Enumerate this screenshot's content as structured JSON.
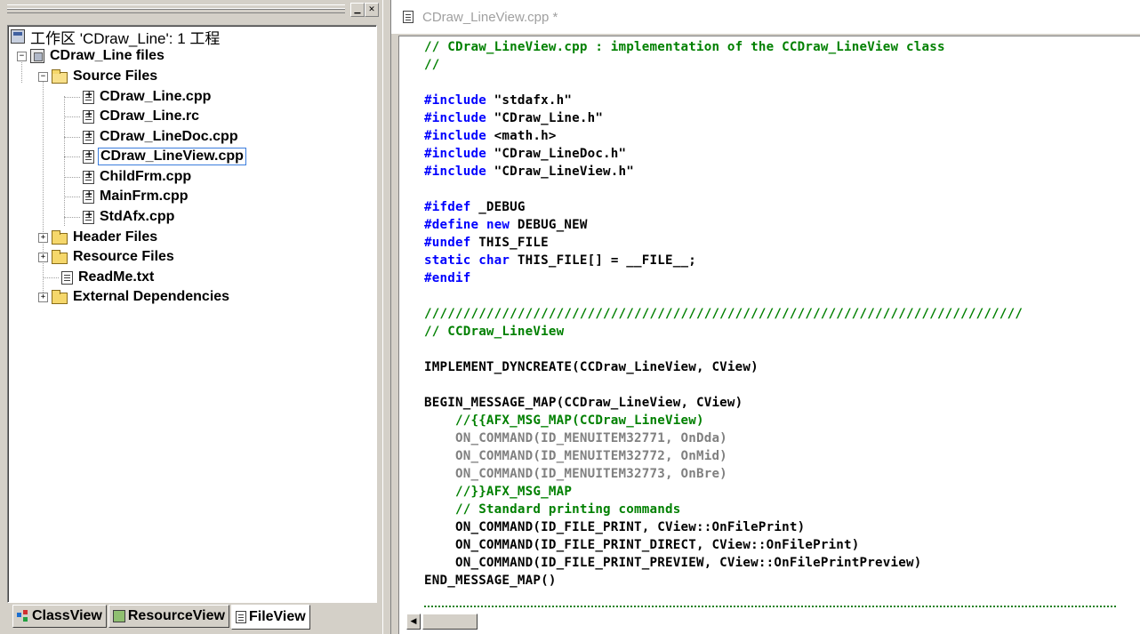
{
  "workspace": {
    "min_glyph": "▁",
    "close_glyph": "✕",
    "tree": [
      {
        "label": "工作区 'CDraw_Line': 1 工程",
        "icon": "workspace-icon"
      },
      {
        "label": "CDraw_Line files",
        "icon": "project-icon",
        "expander": "−"
      },
      {
        "label": "Source Files",
        "icon": "folder-open-icon",
        "expander": "−"
      },
      {
        "label": "CDraw_Line.cpp",
        "icon": "cpp-file-icon"
      },
      {
        "label": "CDraw_Line.rc",
        "icon": "cpp-file-icon"
      },
      {
        "label": "CDraw_LineDoc.cpp",
        "icon": "cpp-file-icon"
      },
      {
        "label": "CDraw_LineView.cpp",
        "icon": "cpp-file-icon",
        "selected": true
      },
      {
        "label": "ChildFrm.cpp",
        "icon": "cpp-file-icon"
      },
      {
        "label": "MainFrm.cpp",
        "icon": "cpp-file-icon"
      },
      {
        "label": "StdAfx.cpp",
        "icon": "cpp-file-icon"
      },
      {
        "label": "Header Files",
        "icon": "folder-icon",
        "expander": "+"
      },
      {
        "label": "Resource Files",
        "icon": "folder-icon",
        "expander": "+"
      },
      {
        "label": "ReadMe.txt",
        "icon": "text-file-icon"
      },
      {
        "label": "External Dependencies",
        "icon": "folder-icon",
        "expander": "+"
      }
    ],
    "tabs": [
      {
        "label": "ClassView",
        "icon": "classview-icon"
      },
      {
        "label": "ResourceView",
        "icon": "resourceview-icon"
      },
      {
        "label": "FileView",
        "icon": "fileview-icon",
        "active": true
      }
    ]
  },
  "editor": {
    "title": "CDraw_LineView.cpp *",
    "scroll_left_glyph": "◀",
    "lines": [
      [
        [
          "// CDraw_LineView.cpp : implementation of the CCDraw_LineView class",
          "comment"
        ]
      ],
      [
        [
          "//",
          "comment"
        ]
      ],
      [],
      [
        [
          "#include",
          "keyword"
        ],
        [
          " \"stdafx.h\"",
          "text"
        ]
      ],
      [
        [
          "#include",
          "keyword"
        ],
        [
          " \"CDraw_Line.h\"",
          "text"
        ]
      ],
      [
        [
          "#include",
          "keyword"
        ],
        [
          " <math.h>",
          "text"
        ]
      ],
      [
        [
          "#include",
          "keyword"
        ],
        [
          " \"CDraw_LineDoc.h\"",
          "text"
        ]
      ],
      [
        [
          "#include",
          "keyword"
        ],
        [
          " \"CDraw_LineView.h\"",
          "text"
        ]
      ],
      [],
      [
        [
          "#ifdef",
          "keyword"
        ],
        [
          " _DEBUG",
          "text"
        ]
      ],
      [
        [
          "#define",
          "keyword"
        ],
        [
          " ",
          "text"
        ],
        [
          "new",
          "keyword"
        ],
        [
          " DEBUG_NEW",
          "text"
        ]
      ],
      [
        [
          "#undef",
          "keyword"
        ],
        [
          " THIS_FILE",
          "text"
        ]
      ],
      [
        [
          "static",
          "keyword"
        ],
        [
          " ",
          "text"
        ],
        [
          "char",
          "keyword"
        ],
        [
          " THIS_FILE[] = __FILE__;",
          "text"
        ]
      ],
      [
        [
          "#endif",
          "keyword"
        ]
      ],
      [],
      [
        [
          "/////////////////////////////////////////////////////////////////////////////",
          "comment"
        ]
      ],
      [
        [
          "// CCDraw_LineView",
          "comment"
        ]
      ],
      [],
      [
        [
          "IMPLEMENT_DYNCREATE(CCDraw_LineView, CView)",
          "text"
        ]
      ],
      [],
      [
        [
          "BEGIN_MESSAGE_MAP(CCDraw_LineView, CView)",
          "text"
        ]
      ],
      [
        [
          "    //{{AFX_MSG_MAP(CCDraw_LineView)",
          "comment"
        ]
      ],
      [
        [
          "    ON_COMMAND(ID_MENUITEM32771, OnDda)",
          "gray"
        ]
      ],
      [
        [
          "    ON_COMMAND(ID_MENUITEM32772, OnMid)",
          "gray"
        ]
      ],
      [
        [
          "    ON_COMMAND(ID_MENUITEM32773, OnBre)",
          "gray"
        ]
      ],
      [
        [
          "    //}}AFX_MSG_MAP",
          "comment"
        ]
      ],
      [
        [
          "    // Standard printing commands",
          "comment"
        ]
      ],
      [
        [
          "    ON_COMMAND(ID_FILE_PRINT, CView::OnFilePrint)",
          "text"
        ]
      ],
      [
        [
          "    ON_COMMAND(ID_FILE_PRINT_DIRECT, CView::OnFilePrint)",
          "text"
        ]
      ],
      [
        [
          "    ON_COMMAND(ID_FILE_PRINT_PREVIEW, CView::OnFilePrintPreview)",
          "text"
        ]
      ],
      [
        [
          "END_MESSAGE_MAP()",
          "text"
        ]
      ]
    ]
  },
  "colors": {
    "keyword": "#0000ff",
    "comment": "#008000",
    "text": "#000000",
    "gray": "#808080",
    "selection_border": "#3b7ddd"
  }
}
